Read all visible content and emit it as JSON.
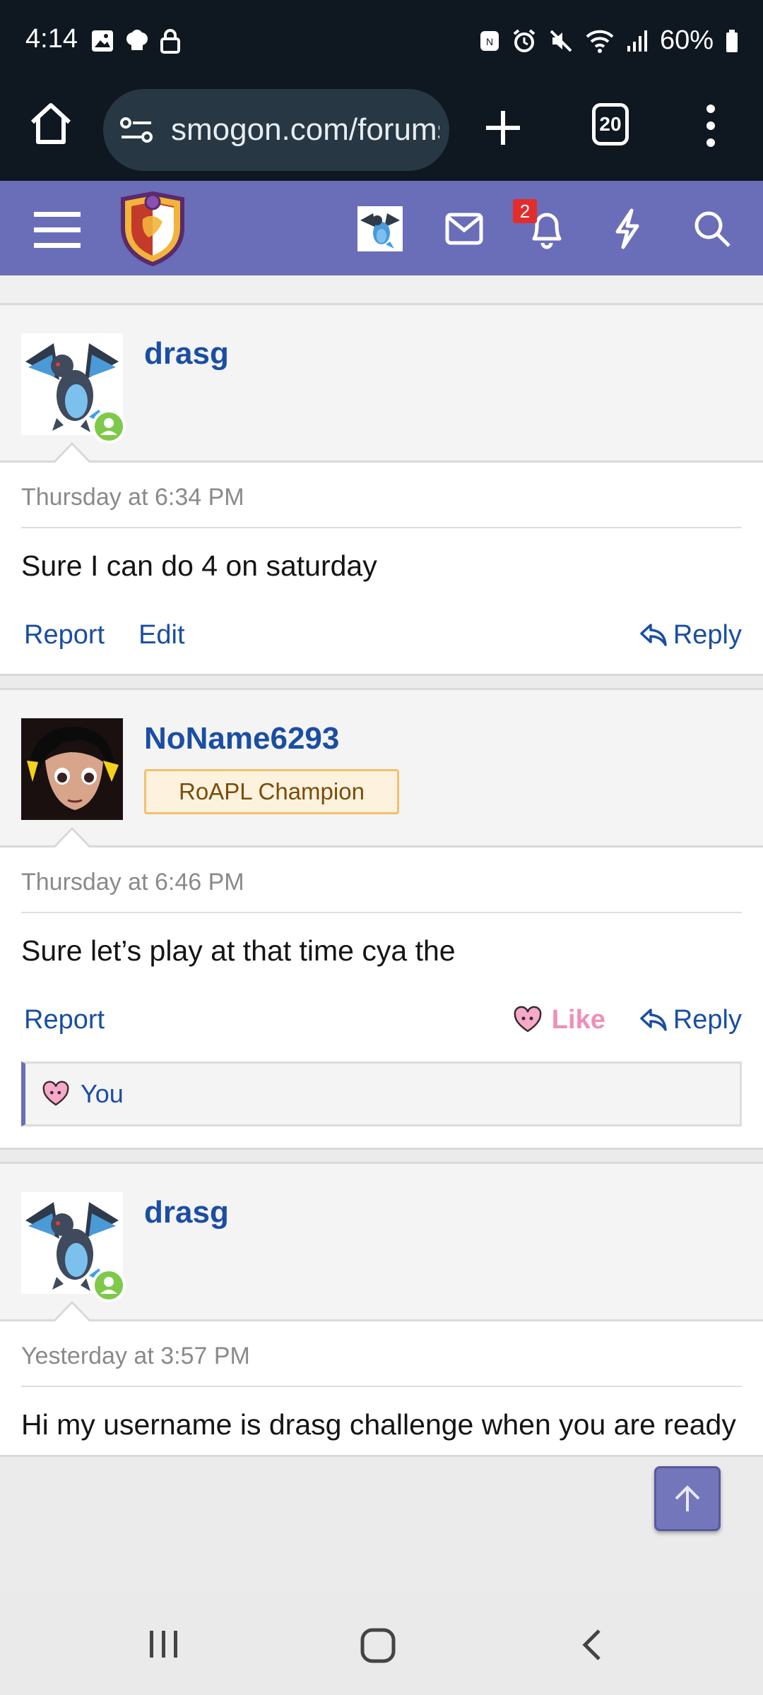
{
  "status_bar": {
    "time": "4:14",
    "battery": "60%"
  },
  "browser": {
    "url": "smogon.com/forums",
    "tab_count": "20"
  },
  "forum_nav": {
    "notification_count": "2"
  },
  "posts": [
    {
      "username": "drasg",
      "user_title": "",
      "online": true,
      "date": "Thursday at 6:34 PM",
      "text": "Sure I can do 4 on saturday",
      "actions": {
        "report": "Report",
        "edit": "Edit",
        "reply": "Reply"
      }
    },
    {
      "username": "NoName6293",
      "user_title": "RoAPL Champion",
      "online": false,
      "date": "Thursday at 6:46 PM",
      "text": "Sure let’s play at that time cya the",
      "actions": {
        "report": "Report",
        "like": "Like",
        "reply": "Reply"
      },
      "reactions": "You"
    },
    {
      "username": "drasg",
      "user_title": "",
      "online": true,
      "date": "Yesterday at 3:57 PM",
      "text": "Hi my username is drasg challenge when you are ready"
    }
  ],
  "colors": {
    "nav_purple": "#6a6db8",
    "link_blue": "#1a4ea3",
    "like_pink": "#ef8fb8",
    "badge_red": "#e32d2d",
    "online_green": "#7ec94a"
  }
}
